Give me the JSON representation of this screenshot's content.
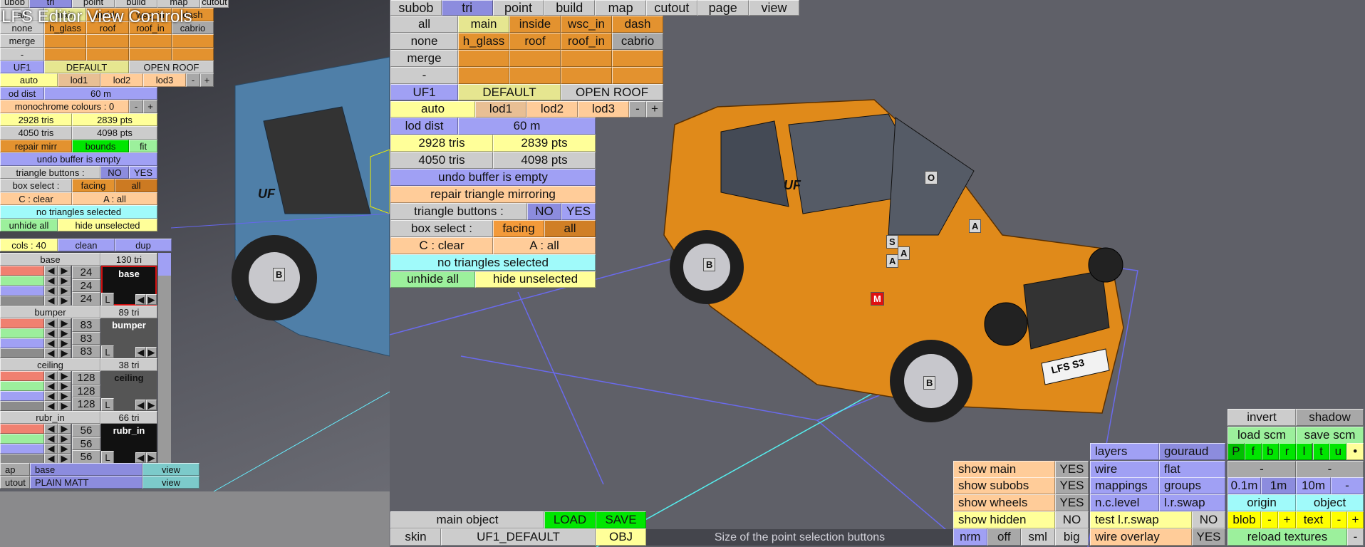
{
  "left_panel": {
    "title": "LFS Editor View Controls",
    "tabs": [
      "ubob",
      "tri",
      "point",
      "build",
      "map",
      "cutout"
    ],
    "select_buttons": [
      "all",
      "none",
      "merge",
      "-"
    ],
    "subobjects": [
      "main",
      "inside",
      "wsc_in",
      "dash",
      "h_glass",
      "roof",
      "roof_in",
      "cabrio"
    ],
    "config": [
      "UF1",
      "DEFAULT",
      "OPEN ROOF"
    ],
    "lod": [
      "auto",
      "lod1",
      "lod2",
      "lod3",
      "-",
      "+"
    ],
    "lod_dist": "od dist",
    "lod_value": "60 m",
    "monochrome": "monochrome colours : 0",
    "minus": "-",
    "plus": "+",
    "stats": [
      "2928 tris",
      "2839 pts",
      "4050 tris",
      "4098 pts"
    ],
    "repair": "repair mirr",
    "bounds": "bounds",
    "fit": "fit",
    "undo": "undo buffer is empty",
    "tri_buttons": "triangle buttons :",
    "no": "NO",
    "yes": "YES",
    "box_select": "box select :",
    "facing": "facing",
    "all": "all",
    "clear": "C : clear",
    "select_all": "A : all",
    "selection": "no triangles selected",
    "unhide": "unhide all",
    "hide": "hide unselected",
    "cols": "cols : 40",
    "clean": "clean",
    "dup": "dup",
    "groups": [
      {
        "name": "base",
        "tris": "130 tri",
        "values": [
          "24",
          "24",
          "24"
        ],
        "preview": "base",
        "lock": "L"
      },
      {
        "name": "bumper",
        "tris": "89 tri",
        "values": [
          "83",
          "83",
          "83"
        ],
        "preview": "bumper",
        "lock": "L"
      },
      {
        "name": "ceiling",
        "tris": "38 tri",
        "values": [
          "128",
          "128",
          "128"
        ],
        "preview": "ceiling",
        "lock": "L"
      },
      {
        "name": "rubr_in",
        "tris": "66 tri",
        "values": [
          "56",
          "56",
          "56"
        ],
        "preview": "rubr_in",
        "lock": "L"
      }
    ],
    "maps": [
      [
        "ap",
        "base",
        "view"
      ],
      [
        "utout",
        "PLAIN MATT",
        "view"
      ]
    ],
    "car_labels": [
      "UF",
      "B"
    ]
  },
  "main_panel": {
    "tabs": [
      "subob",
      "tri",
      "point",
      "build",
      "map",
      "cutout",
      "page",
      "view"
    ],
    "active_tab": "tri",
    "select_buttons": [
      "all",
      "none",
      "merge",
      "-"
    ],
    "subobjects": [
      "main",
      "inside",
      "wsc_in",
      "dash",
      "h_glass",
      "roof",
      "roof_in",
      "cabrio"
    ],
    "config": [
      "UF1",
      "DEFAULT",
      "OPEN ROOF"
    ],
    "lod": [
      "auto",
      "lod1",
      "lod2",
      "lod3",
      "-",
      "+"
    ],
    "lod_dist": "lod dist",
    "lod_value": "60 m",
    "stats": [
      "2928 tris",
      "2839 pts",
      "4050 tris",
      "4098 pts"
    ],
    "undo": "undo buffer is empty",
    "repair": "repair triangle mirroring",
    "tri_buttons": "triangle buttons :",
    "no": "NO",
    "yes": "YES",
    "box_select": "box select :",
    "facing": "facing",
    "all": "all",
    "clear": "C : clear",
    "select_all": "A : all",
    "selection": "no triangles selected",
    "unhide": "unhide all",
    "hide": "hide unselected"
  },
  "viewport": {
    "point_labels": [
      "B",
      "O",
      "S",
      "A",
      "A",
      "A",
      "B",
      "M"
    ],
    "car_text": [
      "UF",
      "LFS S3"
    ]
  },
  "object_bar": {
    "main_object": "main object",
    "load": "LOAD",
    "save": "SAVE",
    "skin": "skin",
    "skin_value": "UF1_DEFAULT",
    "obj": "OBJ"
  },
  "status": "Size of the point selection buttons",
  "view_panel": {
    "show": [
      [
        "show main",
        "YES"
      ],
      [
        "show subobs",
        "YES"
      ],
      [
        "show wheels",
        "YES"
      ],
      [
        "show hidden",
        "NO"
      ]
    ],
    "size": [
      "nrm",
      "off",
      "sml",
      "big"
    ],
    "render": [
      [
        "layers",
        "gouraud"
      ],
      [
        "wire",
        "flat"
      ],
      [
        "mappings",
        "groups"
      ],
      [
        "n.c.level",
        "l.r.swap"
      ]
    ],
    "test_swap": "test l.r.swap",
    "test_swap_val": "NO",
    "wire_overlay": "wire overlay",
    "wire_overlay_val": "YES",
    "invert": "invert",
    "shadow": "shadow",
    "load_scm": "load scm",
    "save_scm": "save scm",
    "views": [
      "P",
      "f",
      "b",
      "r",
      "l",
      "t",
      "u",
      "•"
    ],
    "dash": [
      "-",
      "-"
    ],
    "grid": [
      "0.1m",
      "1m",
      "10m",
      "-"
    ],
    "origin": "origin",
    "object": "object",
    "blob": "blob",
    "text": "text",
    "minus": "-",
    "plus": "+",
    "reload": "reload textures",
    "reload_minus": "-"
  }
}
